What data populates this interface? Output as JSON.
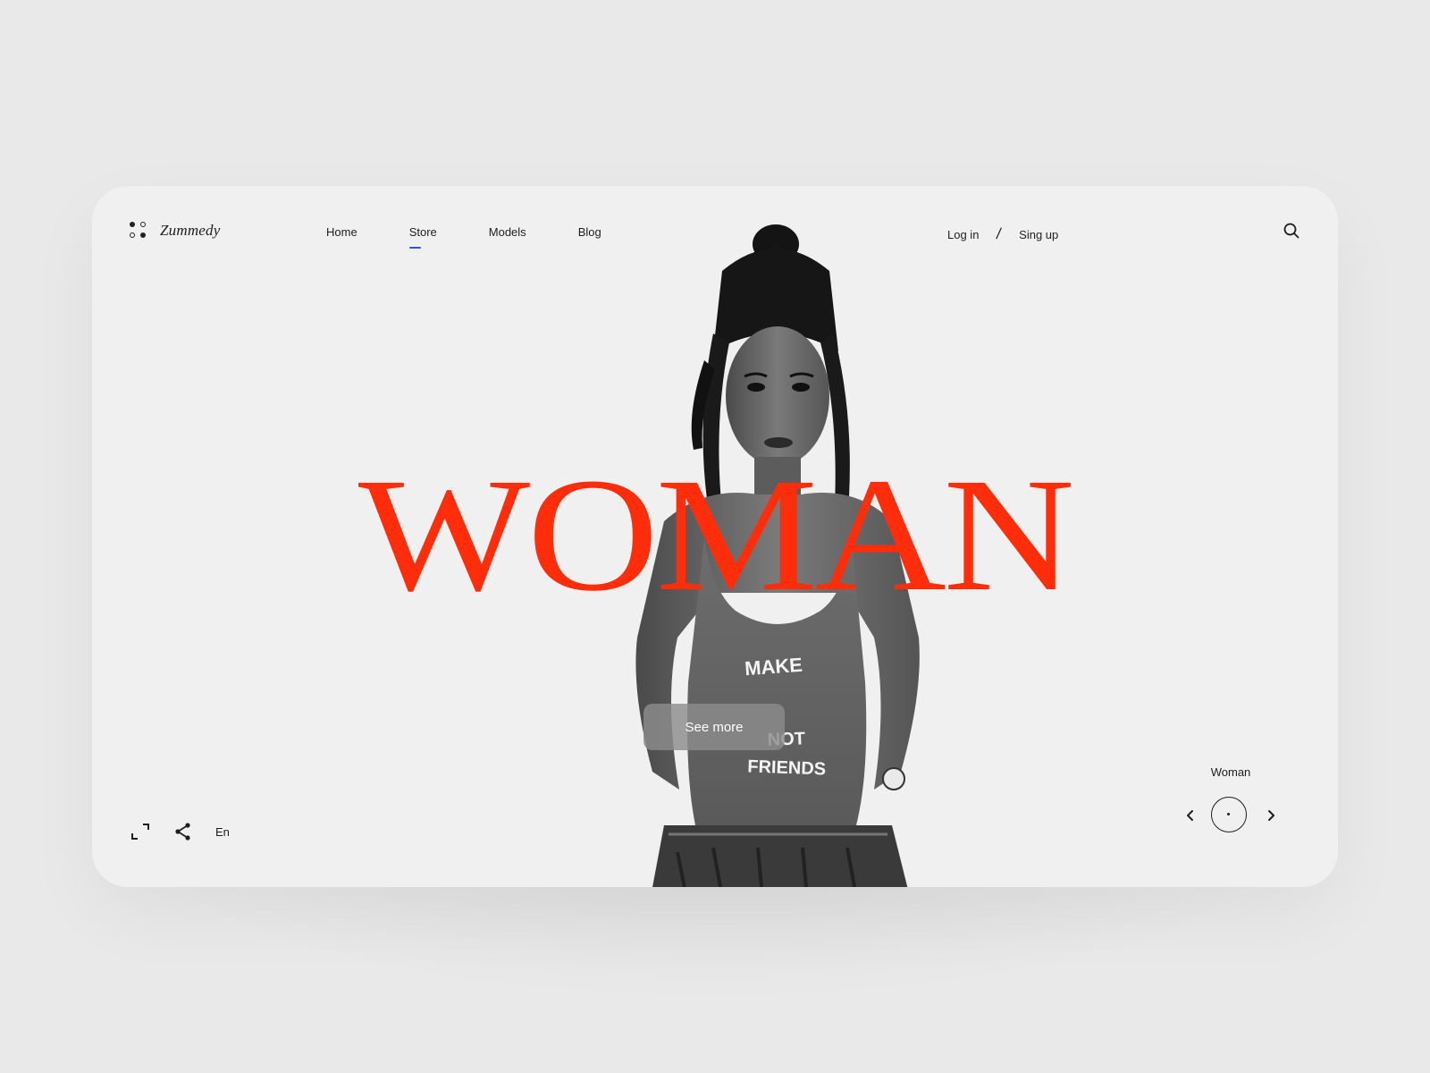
{
  "brand": {
    "name": "Zummedy",
    "icon": "four-dots-logo-icon"
  },
  "nav": {
    "items": [
      {
        "label": "Home"
      },
      {
        "label": "Store",
        "active": true
      },
      {
        "label": "Models"
      },
      {
        "label": "Blog"
      }
    ],
    "active_color": "#2b54e6"
  },
  "auth": {
    "login": "Log in",
    "separator": "/",
    "signup": "Sing up"
  },
  "search": {
    "icon": "search-icon"
  },
  "hero": {
    "headline": "WOMAN",
    "headline_color": "#ff2d0a",
    "cta": "See more",
    "shirt_text": [
      "MAKE",
      "NOT",
      "FRIENDS"
    ]
  },
  "footer_controls": {
    "fullscreen_icon": "fullscreen-icon",
    "share_icon": "share-icon",
    "language": "En"
  },
  "slider": {
    "label": "Woman",
    "prev_icon": "chevron-left-icon",
    "next_icon": "chevron-right-icon"
  },
  "colors": {
    "background": "#e9e9e9",
    "card": "#f0f0f0",
    "text": "#1e1e1e"
  }
}
